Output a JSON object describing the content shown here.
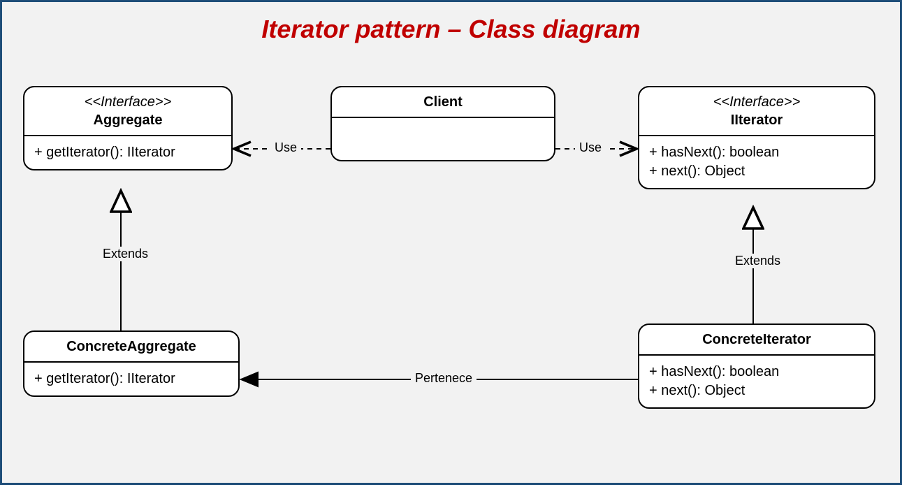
{
  "title": "Iterator pattern – Class diagram",
  "boxes": {
    "aggregate": {
      "stereotype": "<<Interface>>",
      "name": "Aggregate",
      "methods": [
        "+ getIterator(): IIterator"
      ]
    },
    "client": {
      "name": "Client",
      "methods": []
    },
    "iiterator": {
      "stereotype": "<<Interface>>",
      "name": "IIterator",
      "methods": [
        "+ hasNext(): boolean",
        "+ next(): Object"
      ]
    },
    "concreteAggregate": {
      "name": "ConcreteAggregate",
      "methods": [
        "+ getIterator(): IIterator"
      ]
    },
    "concreteIterator": {
      "name": "ConcreteIterator",
      "methods": [
        "+ hasNext(): boolean",
        "+ next(): Object"
      ]
    }
  },
  "edges": {
    "clientToAggregate": "Use",
    "clientToIterator": "Use",
    "aggregateExtend": "Extends",
    "iteratorExtend": "Extends",
    "pertenece": "Pertenece"
  }
}
